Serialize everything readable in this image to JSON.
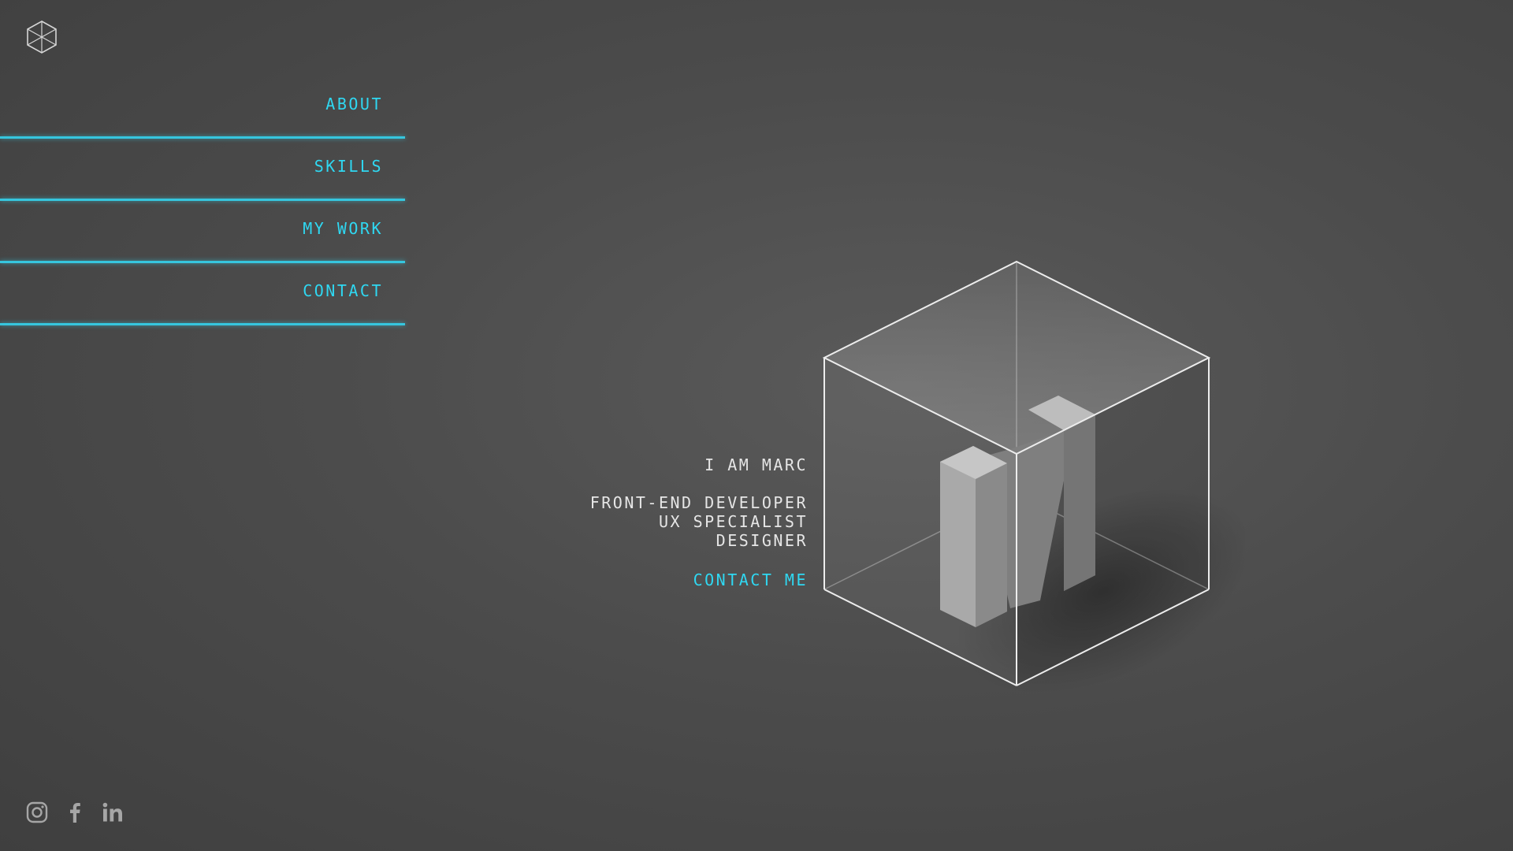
{
  "logo": {
    "icon": "cube-logo-icon"
  },
  "nav": {
    "items": [
      {
        "label": "ABOUT"
      },
      {
        "label": "SKILLS"
      },
      {
        "label": "MY WORK"
      },
      {
        "label": "CONTACT"
      }
    ]
  },
  "intro": {
    "greeting": "I AM MARC",
    "roles": [
      "FRONT-END DEVELOPER",
      "UX SPECIALIST",
      "DESIGNER"
    ],
    "cta": "CONTACT ME"
  },
  "hero": {
    "letter": "M"
  },
  "social": [
    {
      "icon": "instagram-icon"
    },
    {
      "icon": "facebook-icon"
    },
    {
      "icon": "linkedin-icon"
    }
  ],
  "colors": {
    "accent": "#2fd8f2",
    "background": "#4c4c4c",
    "text": "#e6e6e6"
  }
}
